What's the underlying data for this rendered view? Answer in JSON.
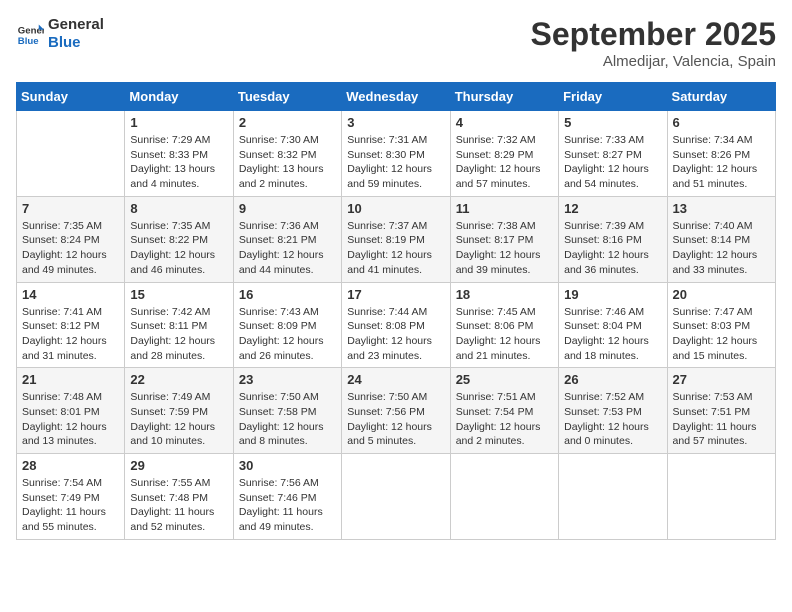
{
  "logo": {
    "line1": "General",
    "line2": "Blue"
  },
  "header": {
    "month": "September 2025",
    "location": "Almedijar, Valencia, Spain"
  },
  "weekdays": [
    "Sunday",
    "Monday",
    "Tuesday",
    "Wednesday",
    "Thursday",
    "Friday",
    "Saturday"
  ],
  "weeks": [
    [
      {
        "day": "",
        "info": ""
      },
      {
        "day": "1",
        "info": "Sunrise: 7:29 AM\nSunset: 8:33 PM\nDaylight: 13 hours\nand 4 minutes."
      },
      {
        "day": "2",
        "info": "Sunrise: 7:30 AM\nSunset: 8:32 PM\nDaylight: 13 hours\nand 2 minutes."
      },
      {
        "day": "3",
        "info": "Sunrise: 7:31 AM\nSunset: 8:30 PM\nDaylight: 12 hours\nand 59 minutes."
      },
      {
        "day": "4",
        "info": "Sunrise: 7:32 AM\nSunset: 8:29 PM\nDaylight: 12 hours\nand 57 minutes."
      },
      {
        "day": "5",
        "info": "Sunrise: 7:33 AM\nSunset: 8:27 PM\nDaylight: 12 hours\nand 54 minutes."
      },
      {
        "day": "6",
        "info": "Sunrise: 7:34 AM\nSunset: 8:26 PM\nDaylight: 12 hours\nand 51 minutes."
      }
    ],
    [
      {
        "day": "7",
        "info": "Sunrise: 7:35 AM\nSunset: 8:24 PM\nDaylight: 12 hours\nand 49 minutes."
      },
      {
        "day": "8",
        "info": "Sunrise: 7:35 AM\nSunset: 8:22 PM\nDaylight: 12 hours\nand 46 minutes."
      },
      {
        "day": "9",
        "info": "Sunrise: 7:36 AM\nSunset: 8:21 PM\nDaylight: 12 hours\nand 44 minutes."
      },
      {
        "day": "10",
        "info": "Sunrise: 7:37 AM\nSunset: 8:19 PM\nDaylight: 12 hours\nand 41 minutes."
      },
      {
        "day": "11",
        "info": "Sunrise: 7:38 AM\nSunset: 8:17 PM\nDaylight: 12 hours\nand 39 minutes."
      },
      {
        "day": "12",
        "info": "Sunrise: 7:39 AM\nSunset: 8:16 PM\nDaylight: 12 hours\nand 36 minutes."
      },
      {
        "day": "13",
        "info": "Sunrise: 7:40 AM\nSunset: 8:14 PM\nDaylight: 12 hours\nand 33 minutes."
      }
    ],
    [
      {
        "day": "14",
        "info": "Sunrise: 7:41 AM\nSunset: 8:12 PM\nDaylight: 12 hours\nand 31 minutes."
      },
      {
        "day": "15",
        "info": "Sunrise: 7:42 AM\nSunset: 8:11 PM\nDaylight: 12 hours\nand 28 minutes."
      },
      {
        "day": "16",
        "info": "Sunrise: 7:43 AM\nSunset: 8:09 PM\nDaylight: 12 hours\nand 26 minutes."
      },
      {
        "day": "17",
        "info": "Sunrise: 7:44 AM\nSunset: 8:08 PM\nDaylight: 12 hours\nand 23 minutes."
      },
      {
        "day": "18",
        "info": "Sunrise: 7:45 AM\nSunset: 8:06 PM\nDaylight: 12 hours\nand 21 minutes."
      },
      {
        "day": "19",
        "info": "Sunrise: 7:46 AM\nSunset: 8:04 PM\nDaylight: 12 hours\nand 18 minutes."
      },
      {
        "day": "20",
        "info": "Sunrise: 7:47 AM\nSunset: 8:03 PM\nDaylight: 12 hours\nand 15 minutes."
      }
    ],
    [
      {
        "day": "21",
        "info": "Sunrise: 7:48 AM\nSunset: 8:01 PM\nDaylight: 12 hours\nand 13 minutes."
      },
      {
        "day": "22",
        "info": "Sunrise: 7:49 AM\nSunset: 7:59 PM\nDaylight: 12 hours\nand 10 minutes."
      },
      {
        "day": "23",
        "info": "Sunrise: 7:50 AM\nSunset: 7:58 PM\nDaylight: 12 hours\nand 8 minutes."
      },
      {
        "day": "24",
        "info": "Sunrise: 7:50 AM\nSunset: 7:56 PM\nDaylight: 12 hours\nand 5 minutes."
      },
      {
        "day": "25",
        "info": "Sunrise: 7:51 AM\nSunset: 7:54 PM\nDaylight: 12 hours\nand 2 minutes."
      },
      {
        "day": "26",
        "info": "Sunrise: 7:52 AM\nSunset: 7:53 PM\nDaylight: 12 hours\nand 0 minutes."
      },
      {
        "day": "27",
        "info": "Sunrise: 7:53 AM\nSunset: 7:51 PM\nDaylight: 11 hours\nand 57 minutes."
      }
    ],
    [
      {
        "day": "28",
        "info": "Sunrise: 7:54 AM\nSunset: 7:49 PM\nDaylight: 11 hours\nand 55 minutes."
      },
      {
        "day": "29",
        "info": "Sunrise: 7:55 AM\nSunset: 7:48 PM\nDaylight: 11 hours\nand 52 minutes."
      },
      {
        "day": "30",
        "info": "Sunrise: 7:56 AM\nSunset: 7:46 PM\nDaylight: 11 hours\nand 49 minutes."
      },
      {
        "day": "",
        "info": ""
      },
      {
        "day": "",
        "info": ""
      },
      {
        "day": "",
        "info": ""
      },
      {
        "day": "",
        "info": ""
      }
    ]
  ]
}
